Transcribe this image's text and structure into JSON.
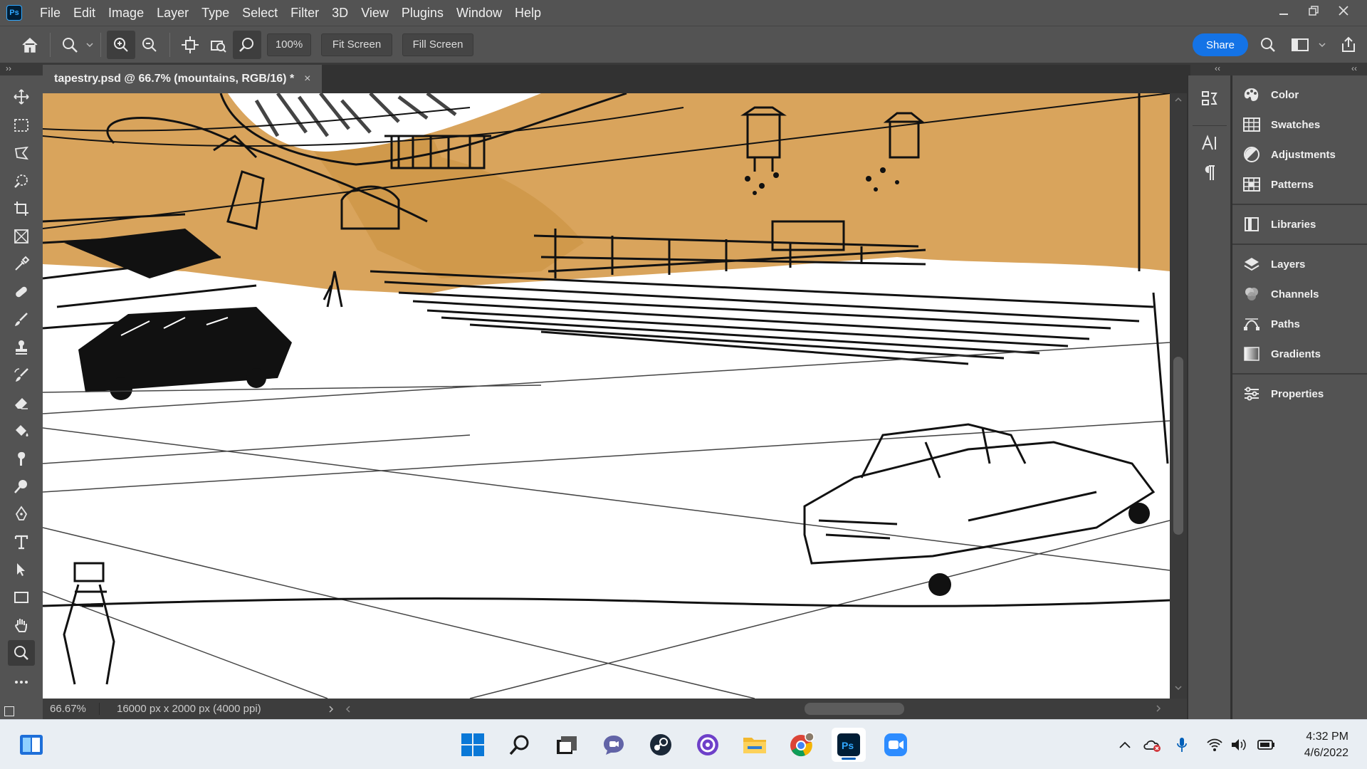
{
  "app": {
    "logo_text": "Ps"
  },
  "menu": [
    "File",
    "Edit",
    "Image",
    "Layer",
    "Type",
    "Select",
    "Filter",
    "3D",
    "View",
    "Plugins",
    "Window",
    "Help"
  ],
  "options": {
    "zoom_value": "100%",
    "fit_screen_label": "Fit Screen",
    "fill_screen_label": "Fill Screen",
    "share_label": "Share"
  },
  "document": {
    "tab_title": "tapestry.psd @ 66.7% (mountains, RGB/16) *",
    "close_glyph": "×"
  },
  "status": {
    "zoom": "66.67%",
    "doc_info": "16000 px x 2000 px (4000 ppi)"
  },
  "panels": {
    "group1": [
      "Color",
      "Swatches",
      "Adjustments",
      "Patterns"
    ],
    "group2": [
      "Libraries"
    ],
    "group3": [
      "Layers",
      "Channels",
      "Paths",
      "Gradients"
    ],
    "group4": [
      "Properties"
    ]
  },
  "tools": [
    "move",
    "marquee",
    "lasso",
    "quick-select",
    "crop",
    "frame",
    "eyedropper",
    "healing",
    "brush",
    "stamp",
    "history-brush",
    "eraser",
    "paint-bucket",
    "smudge",
    "dodge",
    "pen",
    "type",
    "path-select",
    "rectangle",
    "hand",
    "zoom",
    "more"
  ],
  "taskbar": {
    "time": "4:32 PM",
    "date": "4/6/2022"
  },
  "colors": {
    "ui_dark": "#535353",
    "canvas_bg": "#323232",
    "accent": "#1473e6",
    "ochre": "#d9a45c"
  }
}
